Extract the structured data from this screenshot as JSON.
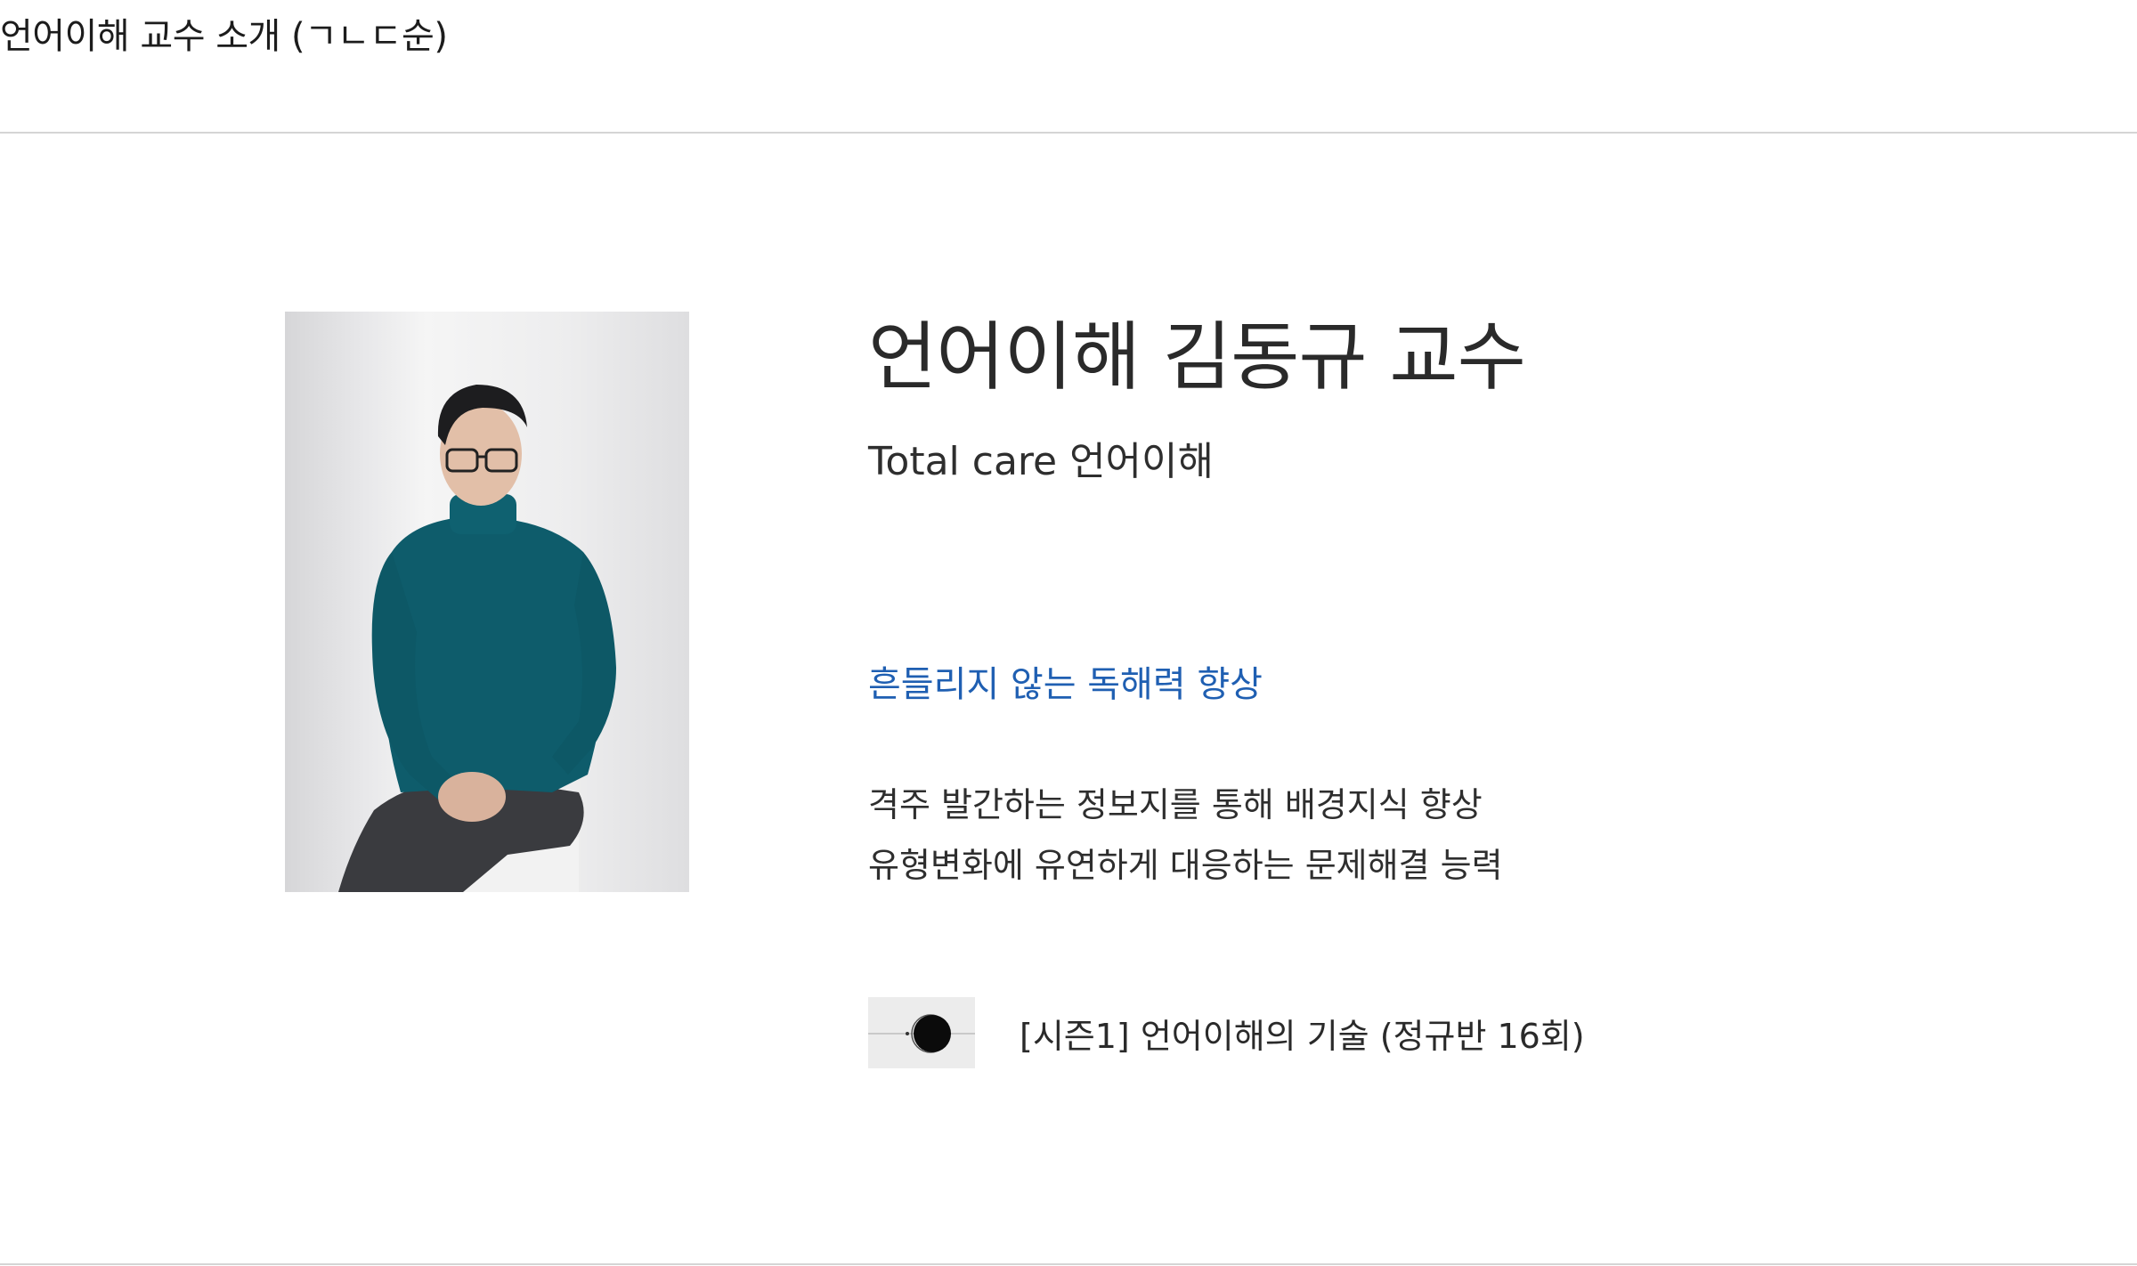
{
  "page": {
    "header": "언어이해 교수 소개 (ㄱㄴㄷ순)"
  },
  "professor": {
    "name": "언어이해 김동규 교수",
    "tagline": "Total care 언어이해",
    "highlight": "흔들리지 않는 독해력 향상",
    "description_lines": [
      "격주 발간하는 정보지를 통해 배경지식 향상",
      "유형변화에 유연하게 대응하는 문제해결 능력"
    ],
    "highlight_color": "#1f5fb2"
  },
  "course": {
    "label": "[시즌1] 언어이해의 기술 (정규반 16회)",
    "thumbnail_icon": "eclipse-icon"
  }
}
